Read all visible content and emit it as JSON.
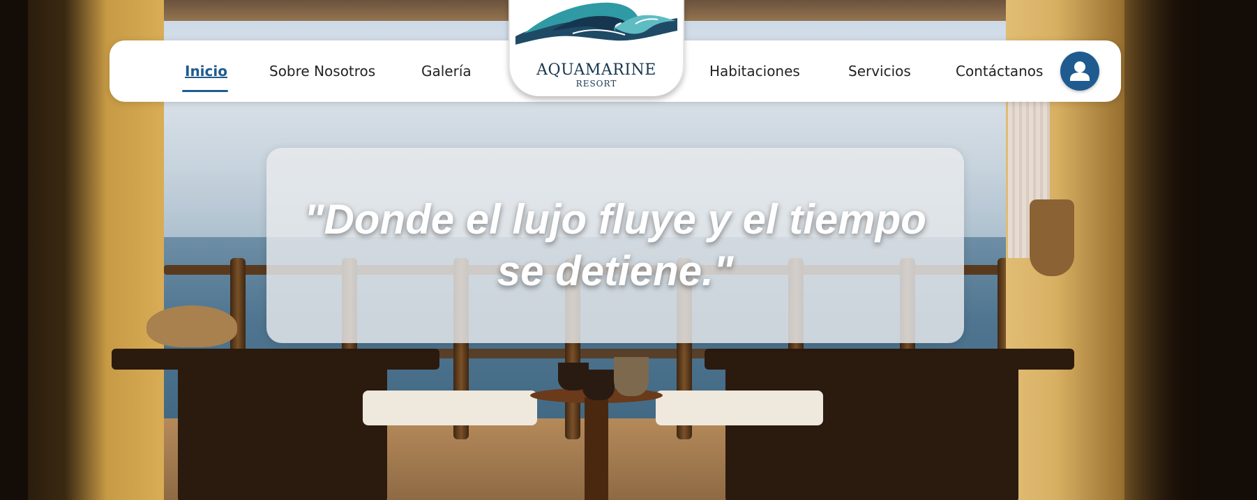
{
  "navbar": {
    "items_left": [
      {
        "label": "Inicio",
        "active": true
      },
      {
        "label": "Sobre Nosotros",
        "active": false
      },
      {
        "label": "Galería",
        "active": false
      }
    ],
    "items_right": [
      {
        "label": "Habitaciones",
        "active": false
      },
      {
        "label": "Servicios",
        "active": false
      },
      {
        "label": "Contáctanos",
        "active": false
      }
    ],
    "logo": {
      "name": "AQUAMARINE",
      "subtitle": "RESORT",
      "icon": "wave-icon"
    },
    "user_icon": "user-icon"
  },
  "hero": {
    "quote": "\"Donde el lujo fluye y el tiempo se detiene.\""
  },
  "colors": {
    "accent": "#1f5b8f",
    "logo_teal": "#2f9aa3",
    "logo_navy": "#16364f",
    "navbar_bg": "#ffffff"
  }
}
